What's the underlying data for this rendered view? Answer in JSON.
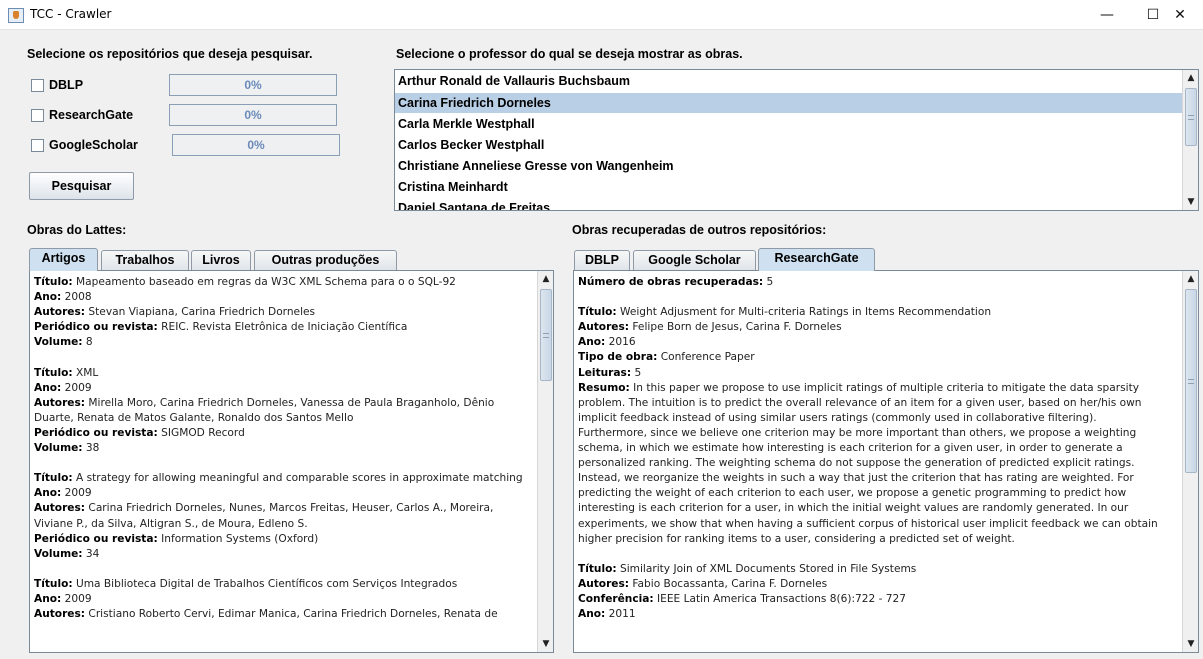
{
  "window": {
    "title": "TCC - Crawler",
    "minimize_glyph": "—",
    "maximize_glyph": "☐",
    "close_glyph": "✕"
  },
  "repositories": {
    "heading": "Selecione os repositórios que deseja pesquisar.",
    "items": [
      {
        "name": "DBLP",
        "checked": false,
        "progress_label": "0%",
        "progress": 0
      },
      {
        "name": "ResearchGate",
        "checked": false,
        "progress_label": "0%",
        "progress": 0
      },
      {
        "name": "GoogleScholar",
        "checked": false,
        "progress_label": "0%",
        "progress": 0
      }
    ],
    "search_button": "Pesquisar"
  },
  "professors": {
    "heading": "Selecione o professor do qual se deseja mostrar as obras.",
    "items": [
      "Arthur Ronald de Vallauris Buchsbaum",
      "Carina Friedrich Dorneles",
      "Carla Merkle Westphall",
      "Carlos Becker Westphall",
      "Christiane Anneliese Gresse von Wangenheim",
      "Cristina Meinhardt",
      "Daniel Santana de Freitas"
    ],
    "selected": "Carina Friedrich Dorneles"
  },
  "lattes": {
    "heading": "Obras do Lattes:",
    "tabs": [
      "Artigos",
      "Trabalhos",
      "Livros",
      "Outras produções"
    ],
    "active_tab": "Artigos",
    "labels": {
      "titulo": "Título:",
      "ano": "Ano:",
      "autores": "Autores:",
      "periodico": "Periódico ou revista:",
      "volume": "Volume:"
    },
    "entries": [
      {
        "titulo": "Mapeamento baseado em regras da W3C XML Schema para o o SQL-92",
        "ano": "2008",
        "autores": "Stevan Viapiana, Carina Friedrich Dorneles",
        "periodico": "REIC. Revista Eletrônica de Iniciação Científica",
        "volume": "8"
      },
      {
        "titulo": "XML",
        "ano": "2009",
        "autores_1": "Mirella Moro, Carina Friedrich Dorneles, Vanessa de Paula Braganholo, Dênio",
        "autores_2": "Duarte, Renata de Matos Galante, Ronaldo dos Santos Mello",
        "periodico": "SIGMOD Record",
        "volume": "38"
      },
      {
        "titulo": "A strategy for allowing meaningful and comparable scores in approximate matching",
        "ano": "2009",
        "autores_1": "Carina Friedrich Dorneles, Nunes, Marcos Freitas, Heuser, Carlos A., Moreira,",
        "autores_2": "Viviane P., da Silva, Altigran S., de Moura, Edleno S.",
        "periodico": "Information Systems (Oxford)",
        "volume": "34"
      },
      {
        "titulo": "Uma Biblioteca Digital de Trabalhos Científicos com Serviços Integrados",
        "ano": "2009",
        "autores_1": "Cristiano Roberto Cervi, Edimar Manica, Carina Friedrich Dorneles, Renata de"
      }
    ]
  },
  "others": {
    "heading": "Obras recuperadas de outros repositórios:",
    "tabs": [
      "DBLP",
      "Google Scholar",
      "ResearchGate"
    ],
    "active_tab": "ResearchGate",
    "count_label": "Número de obras recuperadas:",
    "count": "5",
    "labels": {
      "titulo": "Título:",
      "autores": "Autores:",
      "ano": "Ano:",
      "tipo": "Tipo de obra:",
      "leituras": "Leituras:",
      "resumo": "Resumo:",
      "conferencia": "Conferência:"
    },
    "entry1": {
      "titulo": "Weight Adjusment for Multi-criteria Ratings in Items Recommendation",
      "autores": "Felipe Born de Jesus, Carina F. Dorneles",
      "ano": "2016",
      "tipo": "Conference Paper",
      "leituras": "5",
      "resumo_lines": [
        "In this paper we propose to use implicit ratings of multiple criteria to mitigate the data sparsity",
        "problem. The intuition is to predict the overall relevance of an item for a given user, based on her/his own",
        "implicit feedback instead of using similar users ratings (commonly used in collaborative filtering).",
        "Furthermore, since we believe one criterion may be more important than others, we propose a weighting",
        "schema, in which we estimate how interesting is each criterion for a given user, in order to generate a",
        "personalized ranking. The weighting schema do not suppose the generation of predicted explicit ratings.",
        "Instead, we reorganize the weights in such a way that just the criterion that has rating are weighted. For",
        "predicting the weight of each criterion to each user, we propose a genetic programming to predict how",
        "interesting is each criterion for a user, in which the initial weight values are randomly generated. In our",
        "experiments, we show that when having a sufficient corpus of historical user implicit feedback we can obtain",
        "higher precision for ranking items to a user, considering a predicted set of weight."
      ]
    },
    "entry2": {
      "titulo": "Similarity Join of XML Documents Stored in File Systems",
      "autores": "Fabio Bocassanta, Carina F. Dorneles",
      "conferencia": "IEEE Latin America Transactions 8(6):722 - 727",
      "ano": "2011"
    }
  }
}
